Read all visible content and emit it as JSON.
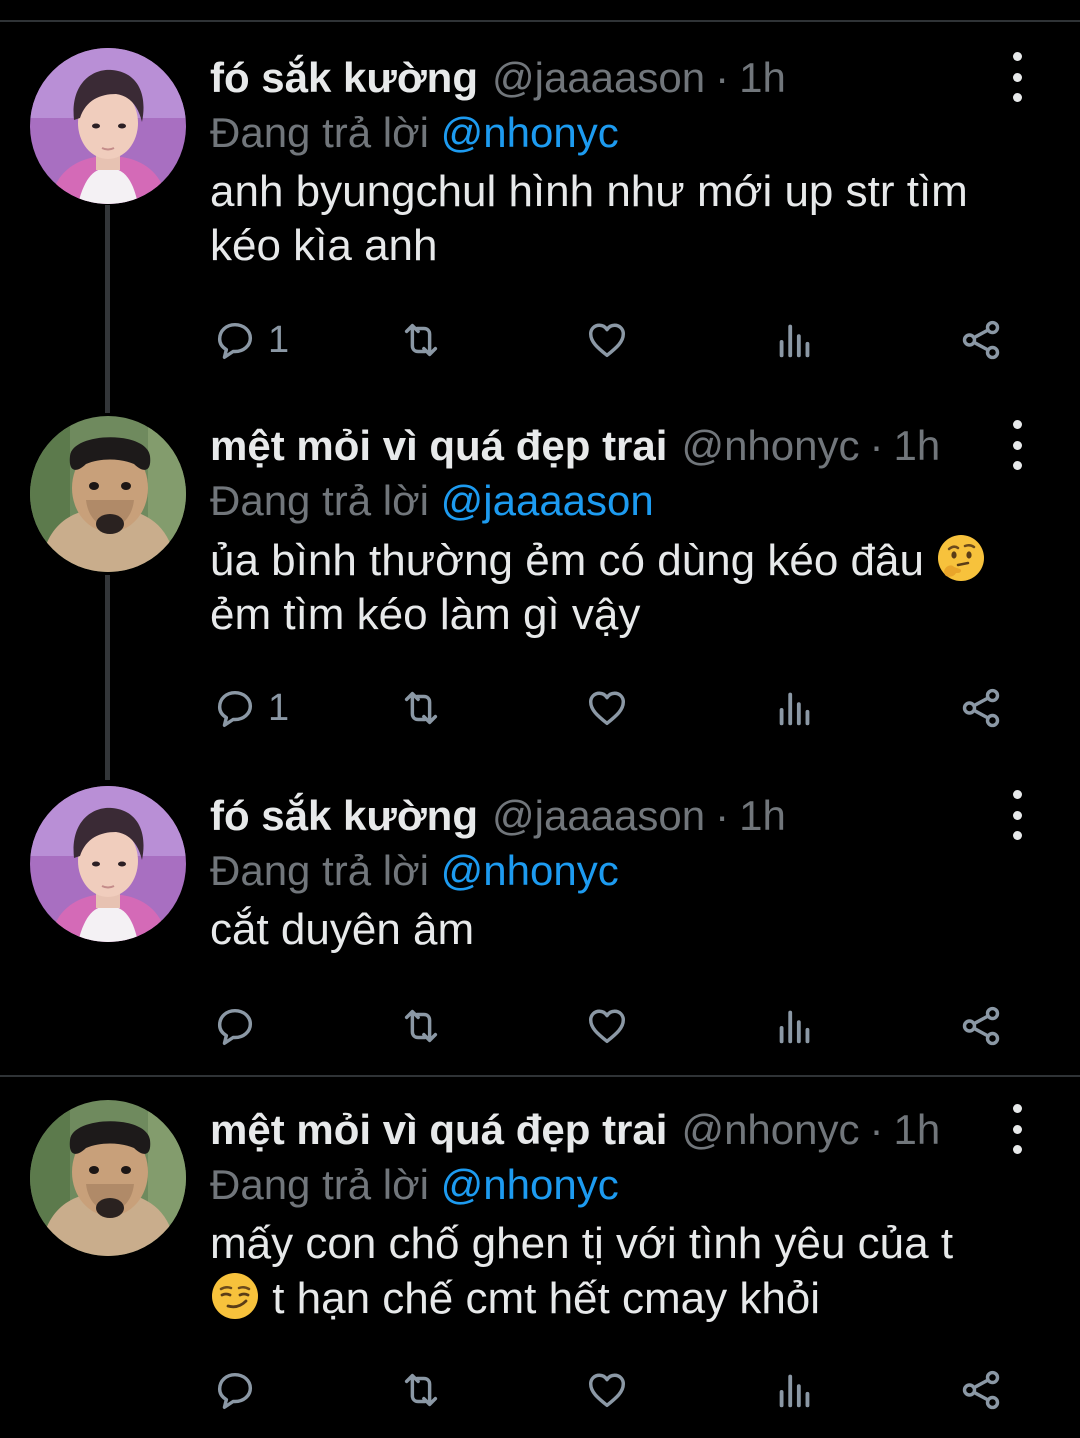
{
  "tweets": [
    {
      "name": "fó sắk kường",
      "handle": "@jaaaason",
      "time": "1h",
      "reply_prefix": "Đang trả lời ",
      "reply_to": "@nhonyc",
      "text_line1": "anh byungchul hình như mới up str tìm",
      "text_line2": "kéo kìa anh",
      "reply_count": "1",
      "avatar": "boy-avatar"
    },
    {
      "name": "mệt mỏi vì quá đẹp trai",
      "handle": "@nhonyc",
      "time": "1h",
      "reply_prefix": "Đang trả lời ",
      "reply_to": "@jaaaason",
      "text_line1": "ủa bình thường ẻm có dùng kéo đâu",
      "text_line1_emoji": "thinking-face",
      "text_line2": "ẻm tìm kéo làm gì vậy",
      "reply_count": "1",
      "avatar": "dog-avatar"
    },
    {
      "name": "fó sắk kường",
      "handle": "@jaaaason",
      "time": "1h",
      "reply_prefix": "Đang trả lời ",
      "reply_to": "@nhonyc",
      "text_line1": "cắt duyên âm",
      "reply_count": "",
      "avatar": "boy-avatar"
    },
    {
      "name": "mệt mỏi vì quá đẹp trai",
      "handle": "@nhonyc",
      "time": "1h",
      "reply_prefix": "Đang trả lời ",
      "reply_to": "@nhonyc",
      "text_line1": "mấy con chố ghen tị với tình yêu của t",
      "text_line2_emoji": "smirking-face",
      "text_line2": " t hạn chế cmt hết cmay khỏi",
      "reply_count": "",
      "avatar": "dog-avatar"
    }
  ],
  "separator_dot": "·",
  "colors": {
    "background": "#000000",
    "text": "#e7e9ea",
    "muted": "#71767b",
    "mention": "#1d9bf0",
    "divider": "#2f3336"
  }
}
